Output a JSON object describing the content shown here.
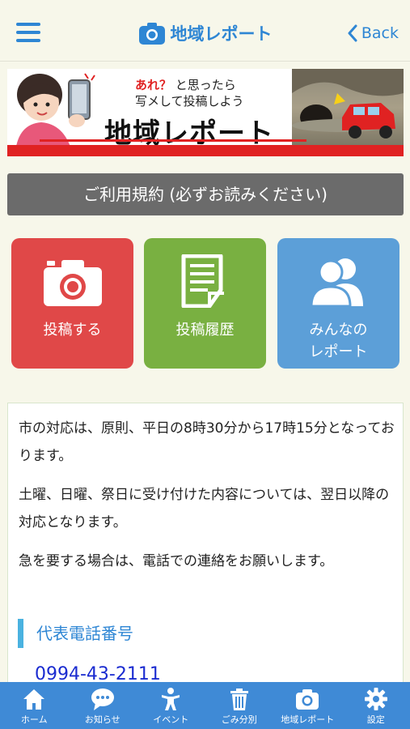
{
  "header": {
    "title": "地域レポート",
    "back_label": "Back"
  },
  "banner": {
    "tagline_1_highlight": "あれ？",
    "tagline_1_rest": "と思ったら",
    "tagline_2": "写メして投稿しよう",
    "title": "地域レポート"
  },
  "terms": {
    "label": "ご利用規約 (必ずお読みください)"
  },
  "actions": {
    "post_label": "投稿する",
    "history_label": "投稿履歴",
    "everyone_label_1": "みんなの",
    "everyone_label_2": "レポート"
  },
  "info": {
    "p1": "市の対応は、原則、平日の8時30分から17時15分となっております。",
    "p2": "土曜、日曜、祭日に受け付けた内容については、翌日以降の対応となります。",
    "p3": "急を要する場合は、電話での連絡をお願いします。",
    "section_title": "代表電話番号",
    "phone": "0994-43-2111"
  },
  "tabs": [
    {
      "label": "ホーム",
      "icon": "home-icon"
    },
    {
      "label": "お知らせ",
      "icon": "chat-icon"
    },
    {
      "label": "イベント",
      "icon": "person-icon"
    },
    {
      "label": "ごみ分別",
      "icon": "trash-icon"
    },
    {
      "label": "地域レポート",
      "icon": "camera-icon"
    },
    {
      "label": "設定",
      "icon": "gear-icon"
    }
  ],
  "colors": {
    "accent": "#2e86d4",
    "post_tile": "#e04848",
    "history_tile": "#79b041",
    "everyone_tile": "#5c9fd8",
    "tabbar": "#3f8ad6"
  }
}
